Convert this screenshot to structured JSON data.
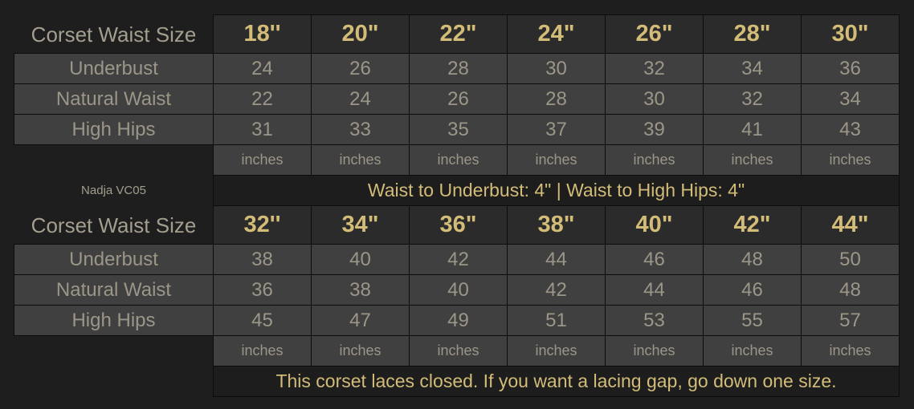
{
  "model_name": "Nadja VC05",
  "row_labels": {
    "header": "Corset Waist Size",
    "underbust": "Underbust",
    "natural_waist": "Natural Waist",
    "high_hips": "High Hips"
  },
  "unit_label": "inches",
  "tables": [
    {
      "sizes": [
        "18''",
        "20\"",
        "22\"",
        "24\"",
        "26\"",
        "28\"",
        "30\""
      ],
      "underbust": [
        "24",
        "26",
        "28",
        "30",
        "32",
        "34",
        "36"
      ],
      "natural_waist": [
        "22",
        "24",
        "26",
        "28",
        "30",
        "32",
        "34"
      ],
      "high_hips": [
        "31",
        "33",
        "35",
        "37",
        "39",
        "41",
        "43"
      ],
      "note": "Waist to Underbust: 4\" | Waist to High Hips: 4\""
    },
    {
      "sizes": [
        "32''",
        "34\"",
        "36\"",
        "38\"",
        "40\"",
        "42\"",
        "44\""
      ],
      "underbust": [
        "38",
        "40",
        "42",
        "44",
        "46",
        "48",
        "50"
      ],
      "natural_waist": [
        "36",
        "38",
        "40",
        "42",
        "44",
        "46",
        "48"
      ],
      "high_hips": [
        "45",
        "47",
        "49",
        "51",
        "53",
        "55",
        "57"
      ],
      "note": "This corset laces closed. If you want a lacing gap, go down one size."
    }
  ],
  "colors": {
    "background": "#1e1e1e",
    "header_cell": "#2b2b2b",
    "data_cell": "#404040",
    "gold_text": "#d2bc78",
    "gray_text": "#9c9688"
  }
}
